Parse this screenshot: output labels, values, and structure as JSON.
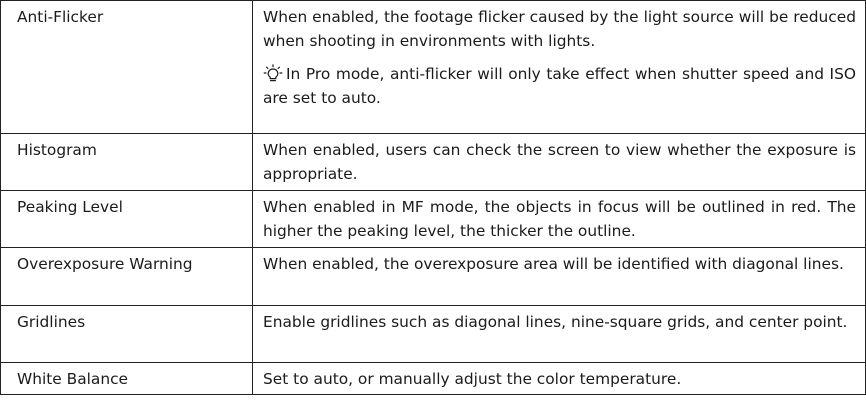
{
  "rows": [
    {
      "name": "Anti-Flicker",
      "desc": "When enabled, the footage flicker caused by the light source will be reduced when shooting in environments with lights.",
      "note": "In Pro mode, anti-flicker will only take effect when shutter speed and ISO are set to auto.",
      "note_icon": "lightbulb-tip-icon"
    },
    {
      "name": "Histogram",
      "desc": "When enabled, users can check the screen to view whether the exposure is appropriate."
    },
    {
      "name": "Peaking Level",
      "desc": "When enabled in MF mode, the objects in focus will be outlined in red. The higher the peaking level, the thicker the outline."
    },
    {
      "name": "Overexposure Warning",
      "desc": "When enabled, the overexposure area will be identified with diagonal lines."
    },
    {
      "name": "Gridlines",
      "desc": "Enable gridlines such as diagonal lines, nine-square grids, and center point."
    },
    {
      "name": "White Balance",
      "desc": "Set to auto, or manually adjust the color temperature."
    }
  ],
  "colors": {
    "border": "#222222",
    "text": "#1b1b1b",
    "background": "#ffffff"
  }
}
